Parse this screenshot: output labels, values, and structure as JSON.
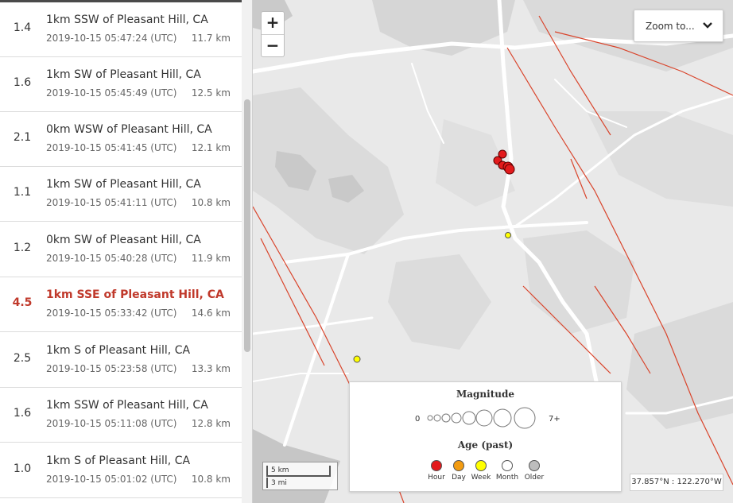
{
  "earthquakes": [
    {
      "mag": "1.4",
      "place": "1km SSW of Pleasant Hill, CA",
      "time": "2019-10-15 05:47:24 (UTC)",
      "depth": "11.7 km",
      "selected": false
    },
    {
      "mag": "1.6",
      "place": "1km SW of Pleasant Hill, CA",
      "time": "2019-10-15 05:45:49 (UTC)",
      "depth": "12.5 km",
      "selected": false
    },
    {
      "mag": "2.1",
      "place": "0km WSW of Pleasant Hill, CA",
      "time": "2019-10-15 05:41:45 (UTC)",
      "depth": "12.1 km",
      "selected": false
    },
    {
      "mag": "1.1",
      "place": "1km SW of Pleasant Hill, CA",
      "time": "2019-10-15 05:41:11 (UTC)",
      "depth": "10.8 km",
      "selected": false
    },
    {
      "mag": "1.2",
      "place": "0km SW of Pleasant Hill, CA",
      "time": "2019-10-15 05:40:28 (UTC)",
      "depth": "11.9 km",
      "selected": false
    },
    {
      "mag": "4.5",
      "place": "1km SSE of Pleasant Hill, CA",
      "time": "2019-10-15 05:33:42 (UTC)",
      "depth": "14.6 km",
      "selected": true
    },
    {
      "mag": "2.5",
      "place": "1km S of Pleasant Hill, CA",
      "time": "2019-10-15 05:23:58 (UTC)",
      "depth": "13.3 km",
      "selected": false
    },
    {
      "mag": "1.6",
      "place": "1km SSW of Pleasant Hill, CA",
      "time": "2019-10-15 05:11:08 (UTC)",
      "depth": "12.8 km",
      "selected": false
    },
    {
      "mag": "1.0",
      "place": "1km S of Pleasant Hill, CA",
      "time": "2019-10-15 05:01:02 (UTC)",
      "depth": "10.8 km",
      "selected": false
    }
  ],
  "map": {
    "zoom_in_label": "+",
    "zoom_out_label": "−",
    "zoom_to_label": "Zoom to...",
    "coordinates": "37.857°N : 122.270°W",
    "scale_km": "5 km",
    "scale_mi": "3 mi"
  },
  "legend": {
    "magnitude_title": "Magnitude",
    "mag_min": "0",
    "mag_max": "7+",
    "age_title": "Age (past)",
    "ages": [
      {
        "label": "Hour",
        "color": "#e31a1c"
      },
      {
        "label": "Day",
        "color": "#f39c12"
      },
      {
        "label": "Week",
        "color": "#ffff00"
      },
      {
        "label": "Month",
        "color": "#ffffff"
      },
      {
        "label": "Older",
        "color": "#bdbdbd"
      }
    ]
  },
  "colors": {
    "selected_text": "#c0392b",
    "fault_line": "#d9442b",
    "quake_hour": "#e31a1c",
    "quake_week": "#ffff00"
  },
  "icons": {
    "zoom_to_dropdown": "chevron-down-icon"
  }
}
